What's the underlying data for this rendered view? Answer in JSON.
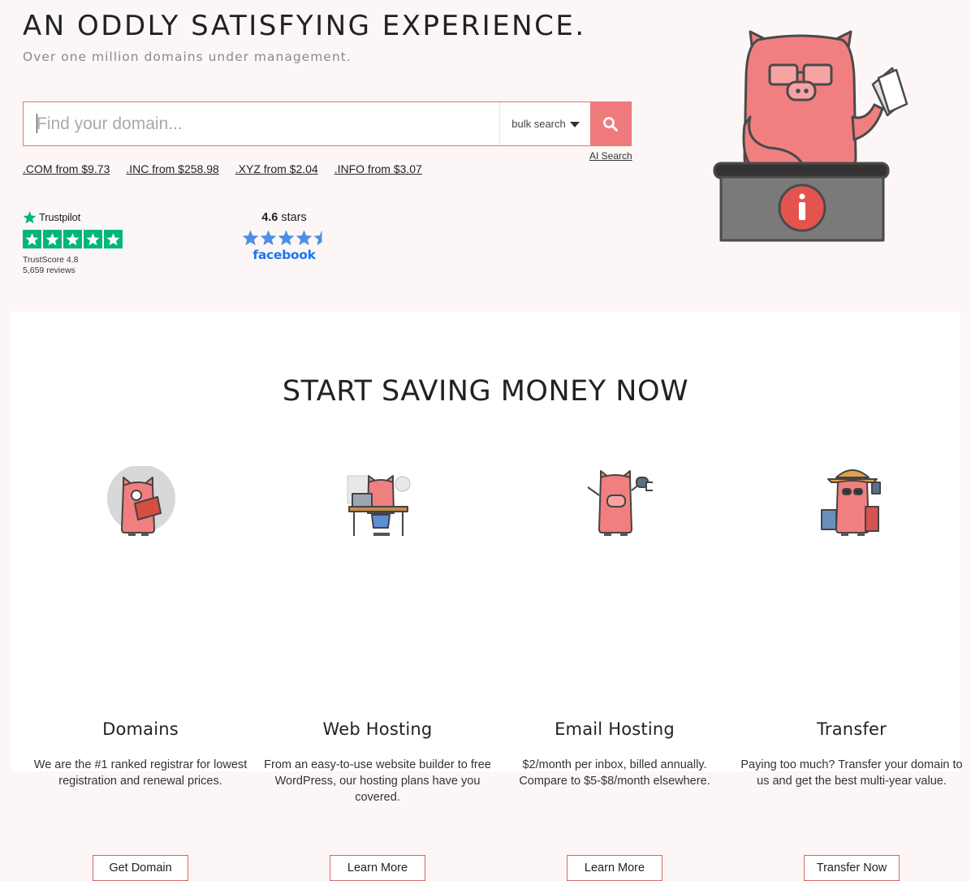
{
  "hero": {
    "title": "AN ODDLY SATISFYING EXPERIENCE.",
    "subtitle": "Over one million domains under management."
  },
  "search": {
    "placeholder": "Find your domain...",
    "bulk_label": "bulk search",
    "ai_search_label": "AI Search"
  },
  "tld_prices": [
    {
      "label": ".COM from $9.73"
    },
    {
      "label": ".INC from $258.98"
    },
    {
      "label": ".XYZ from $2.04"
    },
    {
      "label": ".INFO from $3.07"
    }
  ],
  "trustpilot": {
    "brand": "Trustpilot",
    "score_label": "TrustScore",
    "score": "4.8",
    "reviews": "5,659 reviews",
    "stars": 5,
    "color": "#00b67a"
  },
  "facebook": {
    "rating": "4.6",
    "rating_suffix": " stars",
    "stars": 4.6,
    "brand": "facebook",
    "color": "#1877f2"
  },
  "section": {
    "title": "START SAVING MONEY NOW"
  },
  "cards": [
    {
      "title": "Domains",
      "desc": "We are the #1 ranked registrar for lowest registration and renewal prices.",
      "button": "Get Domain",
      "icon": "pig-reading-globe-icon"
    },
    {
      "title": "Web Hosting",
      "desc": "From an easy-to-use website builder to free WordPress, our hosting plans have you covered.",
      "button": "Learn More",
      "icon": "pig-at-desk-icon"
    },
    {
      "title": "Email Hosting",
      "desc": "$2/month per inbox, billed annually. Compare to $5-$8/month elsewhere.",
      "button": "Learn More",
      "icon": "pig-with-mailbox-icon"
    },
    {
      "title": "Transfer",
      "desc": "Paying too much? Transfer your domain to us and get the best multi-year value.",
      "button": "Transfer Now",
      "icon": "pig-traveler-luggage-icon"
    }
  ],
  "colors": {
    "accent": "#ef7b7d",
    "pig": "#f27f80",
    "page_bg": "#fcf7f6"
  }
}
